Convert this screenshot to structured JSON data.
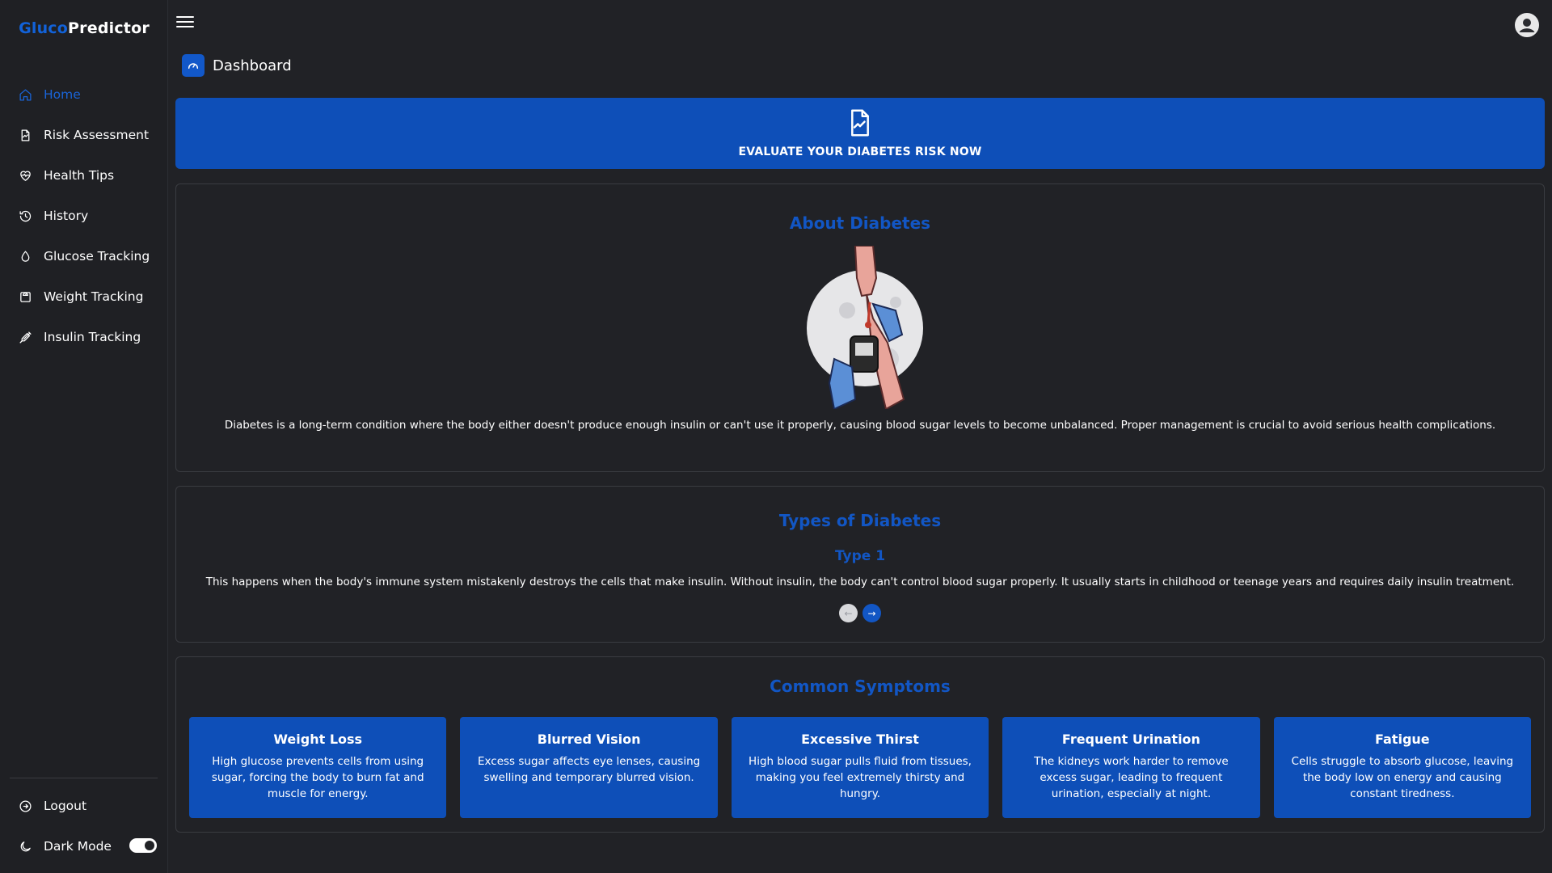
{
  "brand": {
    "part1": "Gluco",
    "part2": "Predictor"
  },
  "sidebar": {
    "items": [
      {
        "label": "Home",
        "icon": "home-icon",
        "active": true
      },
      {
        "label": "Risk Assessment",
        "icon": "document-chart-icon"
      },
      {
        "label": "Health Tips",
        "icon": "heart-pulse-icon"
      },
      {
        "label": "History",
        "icon": "history-icon"
      },
      {
        "label": "Glucose Tracking",
        "icon": "droplet-icon"
      },
      {
        "label": "Weight Tracking",
        "icon": "scale-icon"
      },
      {
        "label": "Insulin Tracking",
        "icon": "syringe-icon"
      }
    ],
    "logout": "Logout",
    "dark_mode": "Dark Mode",
    "dark_mode_on": true
  },
  "header": {
    "title": "Dashboard",
    "menu_icon": "hamburger-icon",
    "avatar_icon": "user-avatar-icon"
  },
  "cta": {
    "label": "EVALUATE YOUR DIABETES RISK NOW",
    "icon": "document-chart-icon"
  },
  "about": {
    "title": "About Diabetes",
    "text": "Diabetes is a long-term condition where the body either doesn't produce enough insulin or can't use it properly, causing blood sugar levels to become unbalanced. Proper management is crucial to avoid serious health complications."
  },
  "types": {
    "title": "Types of Diabetes",
    "current_type": "Type 1",
    "description": "This happens when the body's immune system mistakenly destroys the cells that make insulin. Without insulin, the body can't control blood sugar properly. It usually starts in childhood or teenage years and requires daily insulin treatment.",
    "prev_label": "←",
    "next_label": "→"
  },
  "symptoms": {
    "title": "Common Symptoms",
    "items": [
      {
        "title": "Weight Loss",
        "text": "High glucose prevents cells from using sugar, forcing the body to burn fat and muscle for energy."
      },
      {
        "title": "Blurred Vision",
        "text": "Excess sugar affects eye lenses, causing swelling and temporary blurred vision."
      },
      {
        "title": "Excessive Thirst",
        "text": "High blood sugar pulls fluid from tissues, making you feel extremely thirsty and hungry."
      },
      {
        "title": "Frequent Urination",
        "text": "The kidneys work harder to remove excess sugar, leading to frequent urination, especially at night."
      },
      {
        "title": "Fatigue",
        "text": "Cells struggle to absorb glucose, leaving the body low on energy and causing constant tiredness."
      }
    ]
  },
  "colors": {
    "accent": "#1256c4",
    "card_blue": "#0e4fb8",
    "background": "#212226"
  }
}
